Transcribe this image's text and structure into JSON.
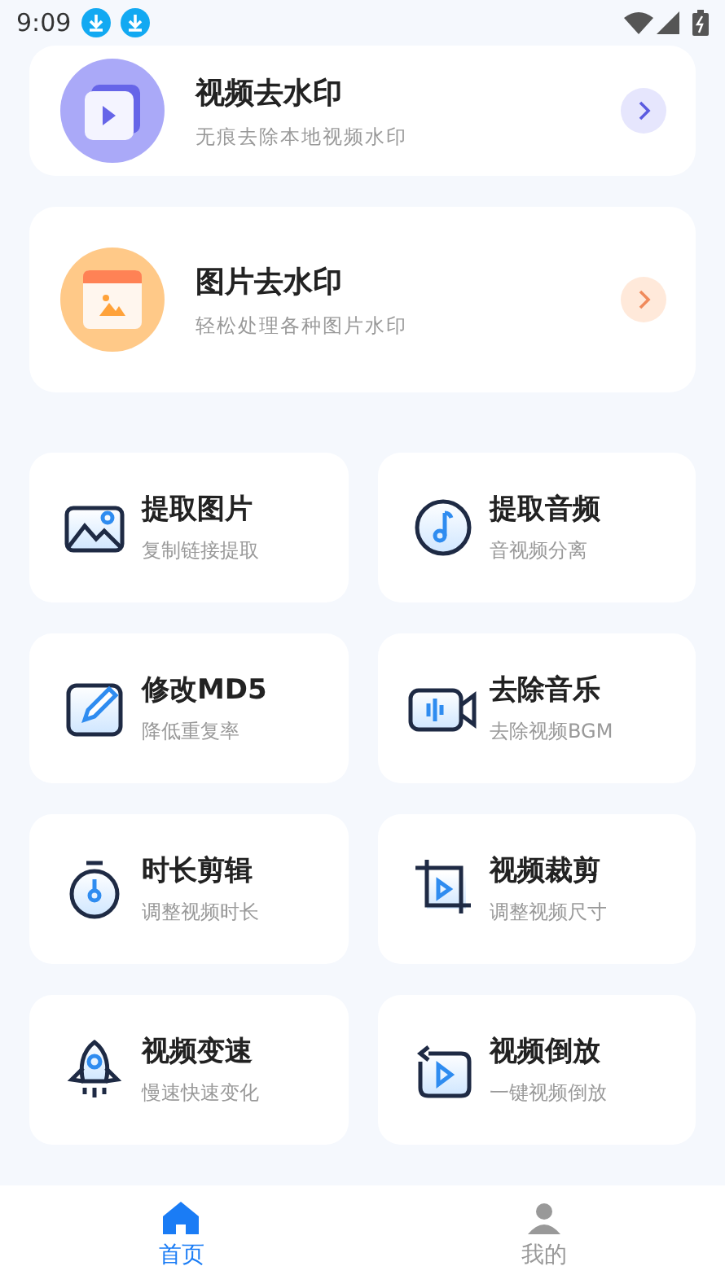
{
  "status_bar": {
    "time": "9:09"
  },
  "feature_cards": [
    {
      "title": "视频去水印",
      "subtitle": "无痕去除本地视频水印"
    },
    {
      "title": "图片去水印",
      "subtitle": "轻松处理各种图片水印"
    }
  ],
  "tools": [
    {
      "title": "提取图片",
      "subtitle": "复制链接提取"
    },
    {
      "title": "提取音频",
      "subtitle": "音视频分离"
    },
    {
      "title": "修改MD5",
      "subtitle": "降低重复率"
    },
    {
      "title": "去除音乐",
      "subtitle": "去除视频BGM"
    },
    {
      "title": "时长剪辑",
      "subtitle": "调整视频时长"
    },
    {
      "title": "视频裁剪",
      "subtitle": "调整视频尺寸"
    },
    {
      "title": "视频变速",
      "subtitle": "慢速快速变化"
    },
    {
      "title": "视频倒放",
      "subtitle": "一键视频倒放"
    }
  ],
  "bottom_nav": [
    {
      "label": "首页",
      "selected": true
    },
    {
      "label": "我的",
      "selected": false
    }
  ]
}
